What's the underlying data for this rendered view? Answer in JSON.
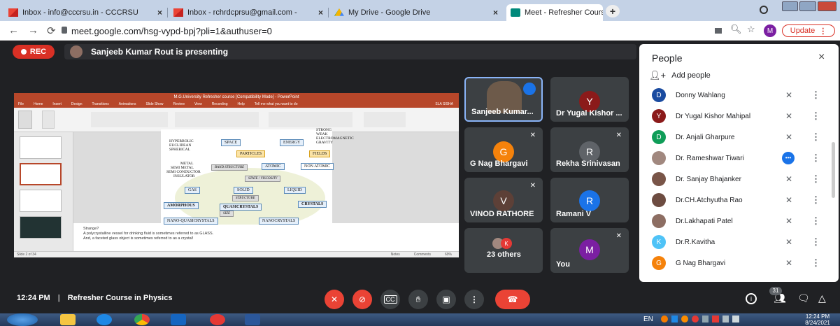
{
  "browser": {
    "tabs": [
      {
        "title": "Inbox - info@cccrsu.in - CCCRSU",
        "close": "×"
      },
      {
        "title": "Inbox - rchrdcprsu@gmail.com -",
        "close": "×"
      },
      {
        "title": "My Drive - Google Drive",
        "close": "×"
      },
      {
        "title": "Meet - Refresher Course in P",
        "close": "×"
      }
    ],
    "new_tab": "+",
    "url": "meet.google.com/hsg-vypd-bpj?pli=1&authuser=0",
    "profile_initial": "M",
    "update_label": "Update"
  },
  "meet": {
    "rec_label": "REC",
    "presenting_text": "Sanjeeb Kumar Rout is presenting",
    "tiles": [
      {
        "name": "Sanjeeb Kumar...",
        "initial": "",
        "color": "#6d5a4a"
      },
      {
        "name": "Dr Yugal Kishor ...",
        "initial": "Y",
        "color": "#8b1a1a"
      },
      {
        "name": "G Nag Bhargavi",
        "initial": "G",
        "color": "#f5820b"
      },
      {
        "name": "Rekha Srinivasan",
        "initial": "R",
        "color": "#5f6368"
      },
      {
        "name": "VINOD RATHORE",
        "initial": "V",
        "color": "#5d4037"
      },
      {
        "name": "Ramani V",
        "initial": "R",
        "color": "#1a73e8"
      },
      {
        "name": "23 others",
        "initial": "K",
        "color": "#e53935"
      },
      {
        "name": "You",
        "initial": "M",
        "color": "#7b1fa2"
      }
    ],
    "clock": "12:24 PM",
    "divider": "|",
    "meeting_title": "Refresher Course in Physics",
    "people_count": "31"
  },
  "slide_app": {
    "window_title": "M.G.University Refresher course [Compatibility Mode] - PowerPoint",
    "user": "SLA SISHA",
    "ribbon_tabs": [
      "File",
      "Home",
      "Insert",
      "Design",
      "Transitions",
      "Animations",
      "Slide Show",
      "Review",
      "View",
      "Recording",
      "Help",
      "Tell me what you want to do"
    ],
    "notes": [
      "Strange?",
      "A polycrystalline vessel for drinking fluid is sometimes referred to as GLASS.",
      "And, a faceted glass object is sometimes referred to as a crystal!"
    ],
    "status": "Slide 2 of 34",
    "notes_label": "Notes",
    "comments_label": "Comments",
    "zoom": "69%"
  },
  "slide": {
    "hyperbolic": "HYPERBOLIC",
    "euclidean": "EUCLIDEAN",
    "spherical": "SPHERICAL",
    "space": "SPACE",
    "energy": "ENERGY",
    "strong": "STRONG",
    "weak": "WEAK",
    "electromagnetic": "ELECTROMAGNETIC",
    "gravity": "GRAVITY",
    "particles": "PARTICLES",
    "fields": "FIELDS",
    "metal": "METAL",
    "semi_metal": "SEMI METAL",
    "semiconductor": "SEMI CONDUCTOR",
    "insulator": "INSULATOR",
    "band_structure": "BAND STRUCTURE",
    "atomic": "ATOMIC",
    "non_atomic": "NON ATOMIC",
    "state_viscosity": "STATE / VISCOSITY",
    "gas": "GAS",
    "solid": "SOLID",
    "liquid": "LIQUID",
    "structure": "STRUCTURE",
    "amorphous": "AMORPHOUS",
    "quasicrystals": "QUASICRYSTALS",
    "crystals": "CRYSTALS",
    "size": "SIZE",
    "nano_quasi": "NANO-QUASICRYSTALS",
    "nanocrystals": "NANOCRYSTALS"
  },
  "people_panel": {
    "title": "People",
    "close": "×",
    "add_label": "Add people",
    "rows": [
      {
        "name": "Donny Wahlang",
        "initial": "D",
        "color": "#1a4ba0"
      },
      {
        "name": "Dr Yugal Kishor Mahipal",
        "initial": "Y",
        "color": "#8b1a1a"
      },
      {
        "name": "Dr. Anjali Gharpure",
        "initial": "D",
        "color": "#0f9d58"
      },
      {
        "name": "Dr. Rameshwar Tiwari",
        "initial": "",
        "color": "#a1887f"
      },
      {
        "name": "Dr. Sanjay Bhajanker",
        "initial": "",
        "color": "#795548"
      },
      {
        "name": "Dr.CH.Atchyutha Rao",
        "initial": "",
        "color": "#6d4c41"
      },
      {
        "name": "Dr.Lakhapati Patel",
        "initial": "",
        "color": "#8d6e63"
      },
      {
        "name": "Dr.R.Kavitha",
        "initial": "K",
        "color": "#4fc3f7"
      },
      {
        "name": "G Nag Bhargavi",
        "initial": "G",
        "color": "#f5820b"
      }
    ]
  },
  "taskbar": {
    "lang": "EN",
    "time": "12:24 PM",
    "date": "8/24/2021"
  }
}
